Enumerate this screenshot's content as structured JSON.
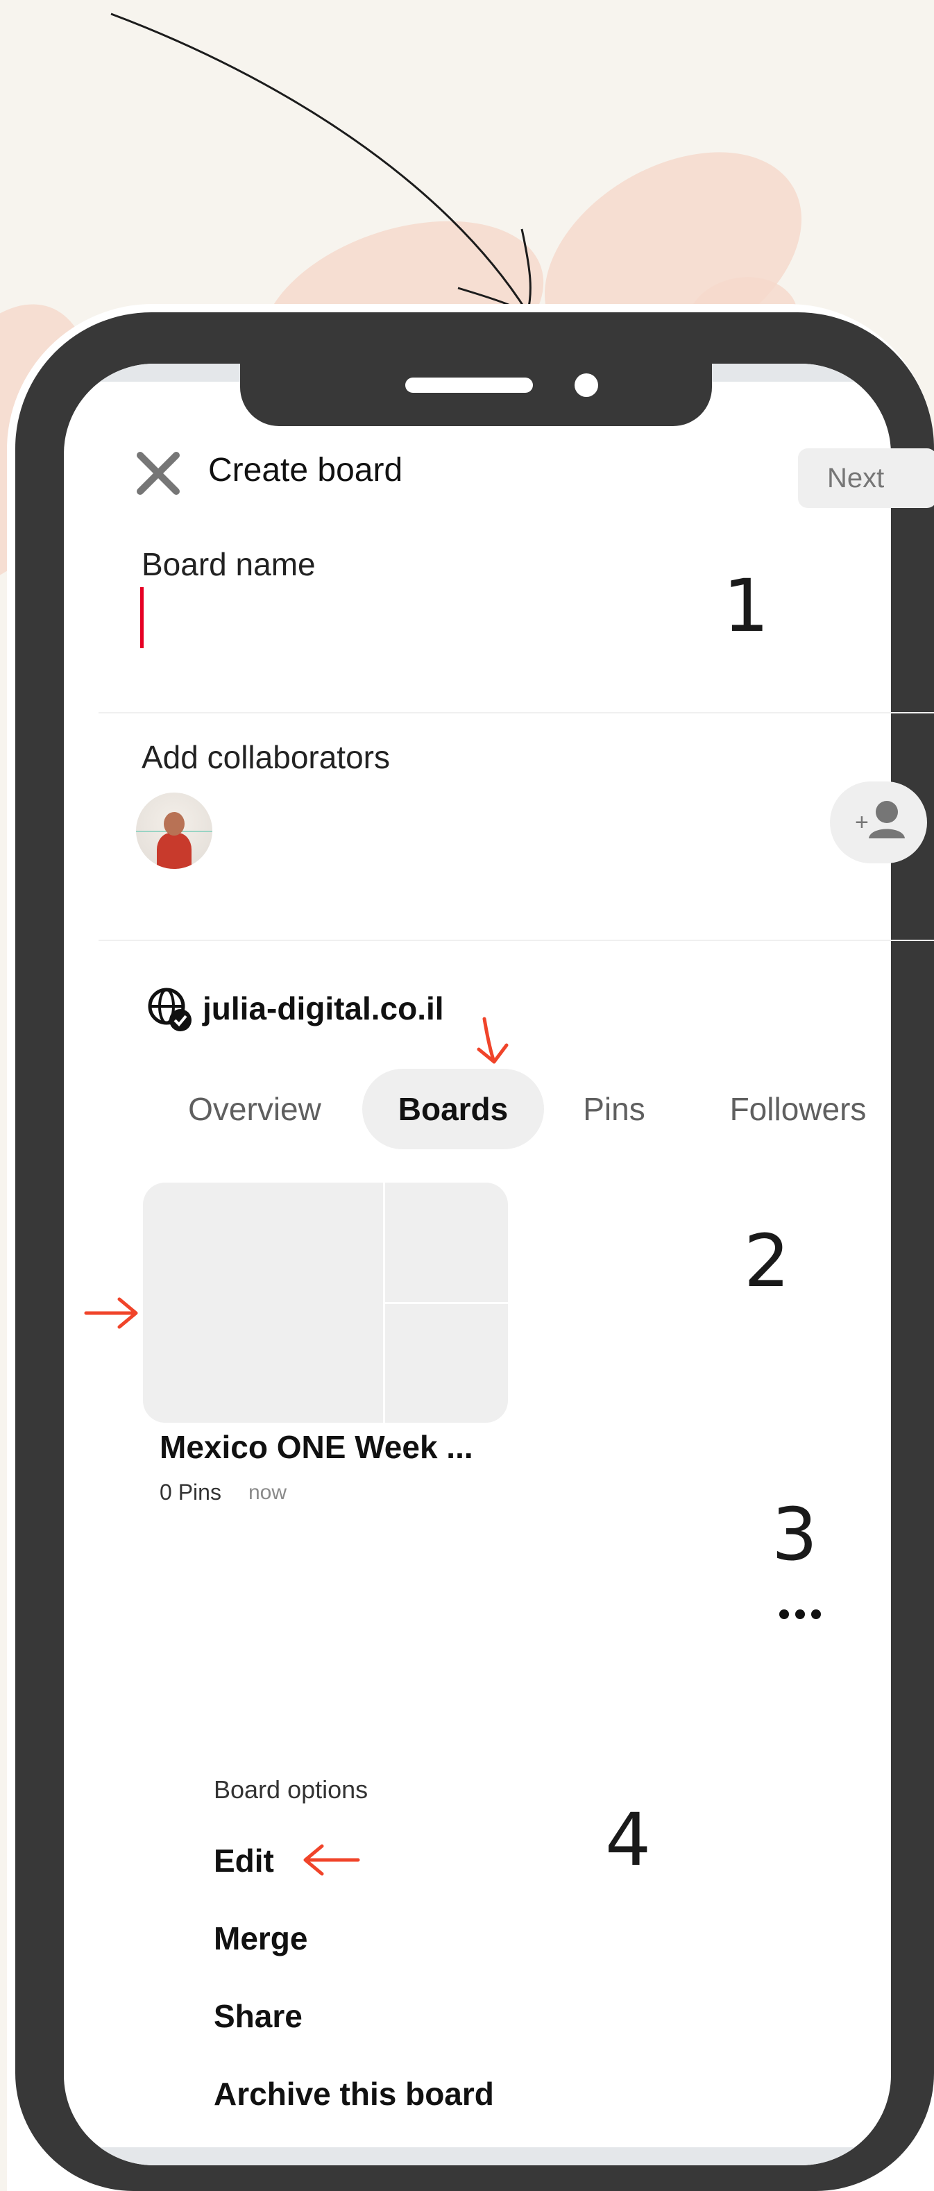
{
  "header": {
    "title": "Create board",
    "next_label": "Next"
  },
  "form": {
    "board_name_label": "Board name",
    "board_name_value": "",
    "collaborators_label": "Add collaborators"
  },
  "profile": {
    "account_name": "julia-digital.co.il",
    "tabs": [
      {
        "label": "Overview",
        "active": false
      },
      {
        "label": "Boards",
        "active": true
      },
      {
        "label": "Pins",
        "active": false
      },
      {
        "label": "Followers",
        "active": false
      }
    ]
  },
  "board": {
    "title": "Mexico ONE Week ...",
    "pins": "0 Pins",
    "time": "now"
  },
  "board_options": {
    "heading": "Board options",
    "items": [
      "Edit",
      "Merge",
      "Share",
      "Archive this board"
    ]
  },
  "steps": [
    "1",
    "2",
    "3",
    "4"
  ],
  "colors": {
    "accent_arrow": "#f0442a",
    "cursor": "#e60023",
    "phone_frame": "#383838",
    "background": "#f7f4ee"
  }
}
